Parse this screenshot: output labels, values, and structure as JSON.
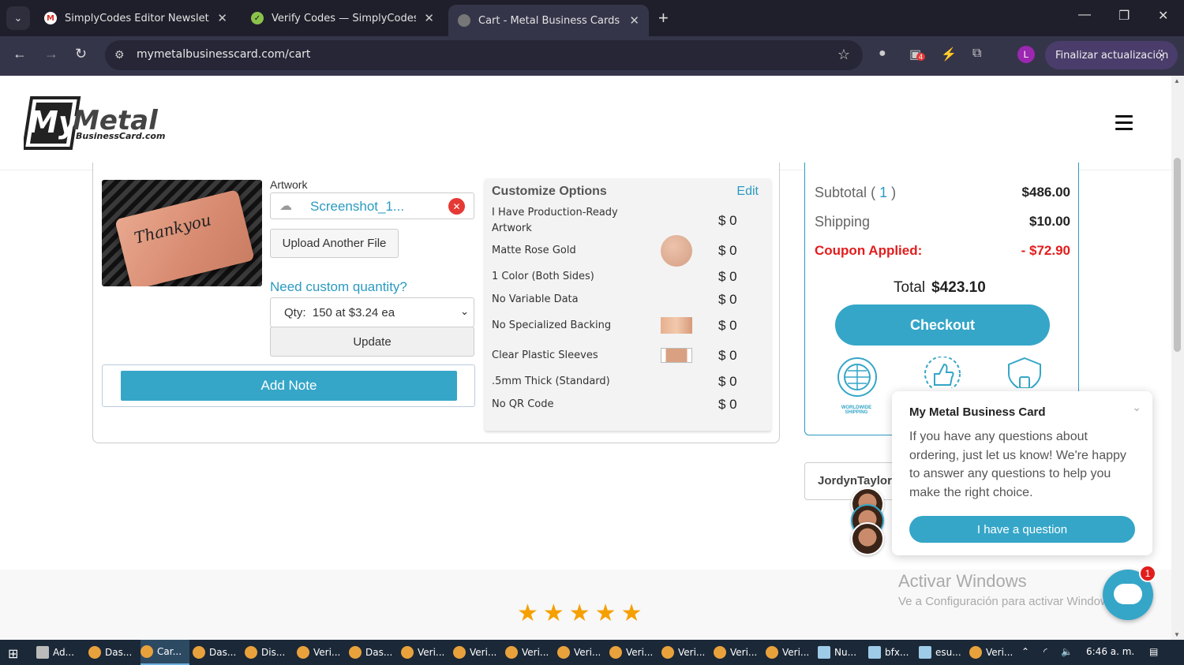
{
  "browser": {
    "tabs": [
      {
        "label": "SimplyCodes Editor Newsletter",
        "icon": "gmail-icon"
      },
      {
        "label": "Verify Codes — SimplyCodes",
        "icon": "simplycodes-icon"
      },
      {
        "label": "Cart - Metal Business Cards | M",
        "icon": "mymetal-icon"
      }
    ],
    "url": "mymetalbusinesscard.com/cart",
    "update_button": "Finalizar actualización",
    "profile_initial": "L",
    "ext_badge": "4"
  },
  "logo": {
    "main": "MyMetal",
    "sub": "BusinessCard.com"
  },
  "cart_item": {
    "artwork_label": "Artwork",
    "file_name": "Screenshot_1...",
    "upload_button": "Upload Another File",
    "need_qty_link": "Need custom quantity?",
    "qty_prefix": "Qty:",
    "qty_value": "150 at $3.24 ea",
    "update_button": "Update",
    "add_note_button": "Add Note",
    "signature": "Thank you"
  },
  "customize": {
    "title": "Customize Options",
    "edit": "Edit",
    "options": [
      {
        "label": "I Have Production-Ready",
        "label2": "Artwork",
        "price": "$ 0"
      },
      {
        "label": "Matte Rose Gold",
        "price": "$ 0"
      },
      {
        "label": "1 Color (Both Sides)",
        "price": "$ 0"
      },
      {
        "label": "No Variable Data",
        "price": "$ 0"
      },
      {
        "label": "No Specialized Backing",
        "price": "$ 0"
      },
      {
        "label": "Clear Plastic Sleeves",
        "price": "$ 0"
      },
      {
        "label": ".5mm Thick (Standard)",
        "price": "$ 0"
      },
      {
        "label": "No QR Code",
        "price": "$ 0"
      }
    ]
  },
  "summary": {
    "subtotal_label": "Subtotal",
    "subtotal_count": "1",
    "subtotal_value": "$486.00",
    "shipping_label": "Shipping",
    "shipping_value": "$10.00",
    "coupon_label": "Coupon Applied:",
    "coupon_value": "- $72.90",
    "total_label": "Total",
    "total_value": "$423.10",
    "checkout_button": "Checkout",
    "worldwide_label": "WORLDWIDE SHIPPING"
  },
  "reviewer": "JordynTaylorM",
  "chat": {
    "title": "My Metal Business Card",
    "body": "If you have any questions about ordering, just let us know! We're happy to answer any questions to help you make the right choice.",
    "button": "I have a question",
    "badge_count": "1"
  },
  "rating": {
    "stars": 5
  },
  "windows_watermark": {
    "line1": "Activar Windows",
    "line2": "Ve a Configuración para activar Windows."
  },
  "taskbar": {
    "items": [
      "Ad...",
      "Das...",
      "Car...",
      "Das...",
      "Dis...",
      "Veri...",
      "Das...",
      "Veri...",
      "Veri...",
      "Veri...",
      "Veri...",
      "Veri...",
      "Veri...",
      "Veri...",
      "Veri...",
      "Nu...",
      "bfx...",
      "esu...",
      "Veri..."
    ],
    "time": "6:46 a. m."
  },
  "colors": {
    "accent": "#35a6c8",
    "coupon": "#e21d1d",
    "star": "#f5a000"
  }
}
